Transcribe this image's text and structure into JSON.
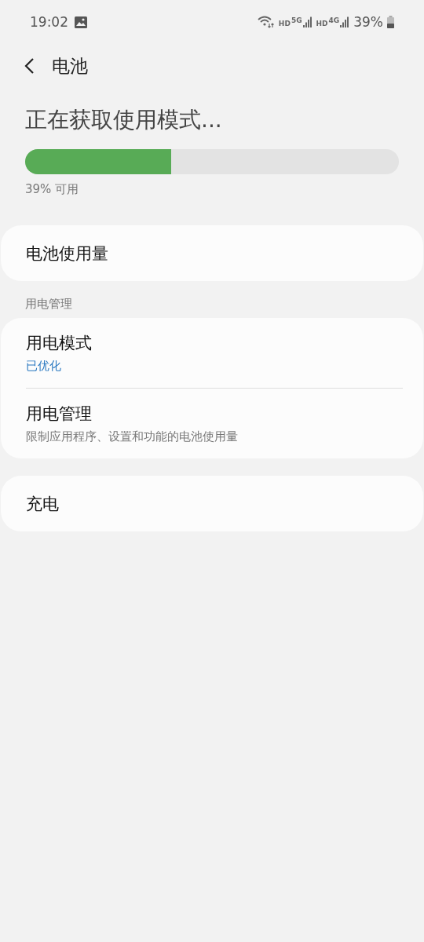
{
  "status_bar": {
    "time": "19:02",
    "network": [
      {
        "label": "HD",
        "generation": "5G"
      },
      {
        "label": "HD",
        "generation": "4G"
      }
    ],
    "battery": "39%"
  },
  "header": {
    "title": "电池"
  },
  "usage": {
    "title": "正在获取使用模式...",
    "level": 0.39,
    "caption": "39% 可用"
  },
  "sections": [
    {
      "items": [
        {
          "title": "电池使用量"
        }
      ]
    },
    {
      "heading": "用电管理",
      "items": [
        {
          "title": "用电模式",
          "subtitle": "已优化",
          "accent": true
        },
        {
          "title": "用电管理",
          "subtitle": "限制应用程序、设置和功能的电池使用量",
          "accent": false
        }
      ]
    },
    {
      "items": [
        {
          "title": "充电"
        }
      ]
    }
  ]
}
